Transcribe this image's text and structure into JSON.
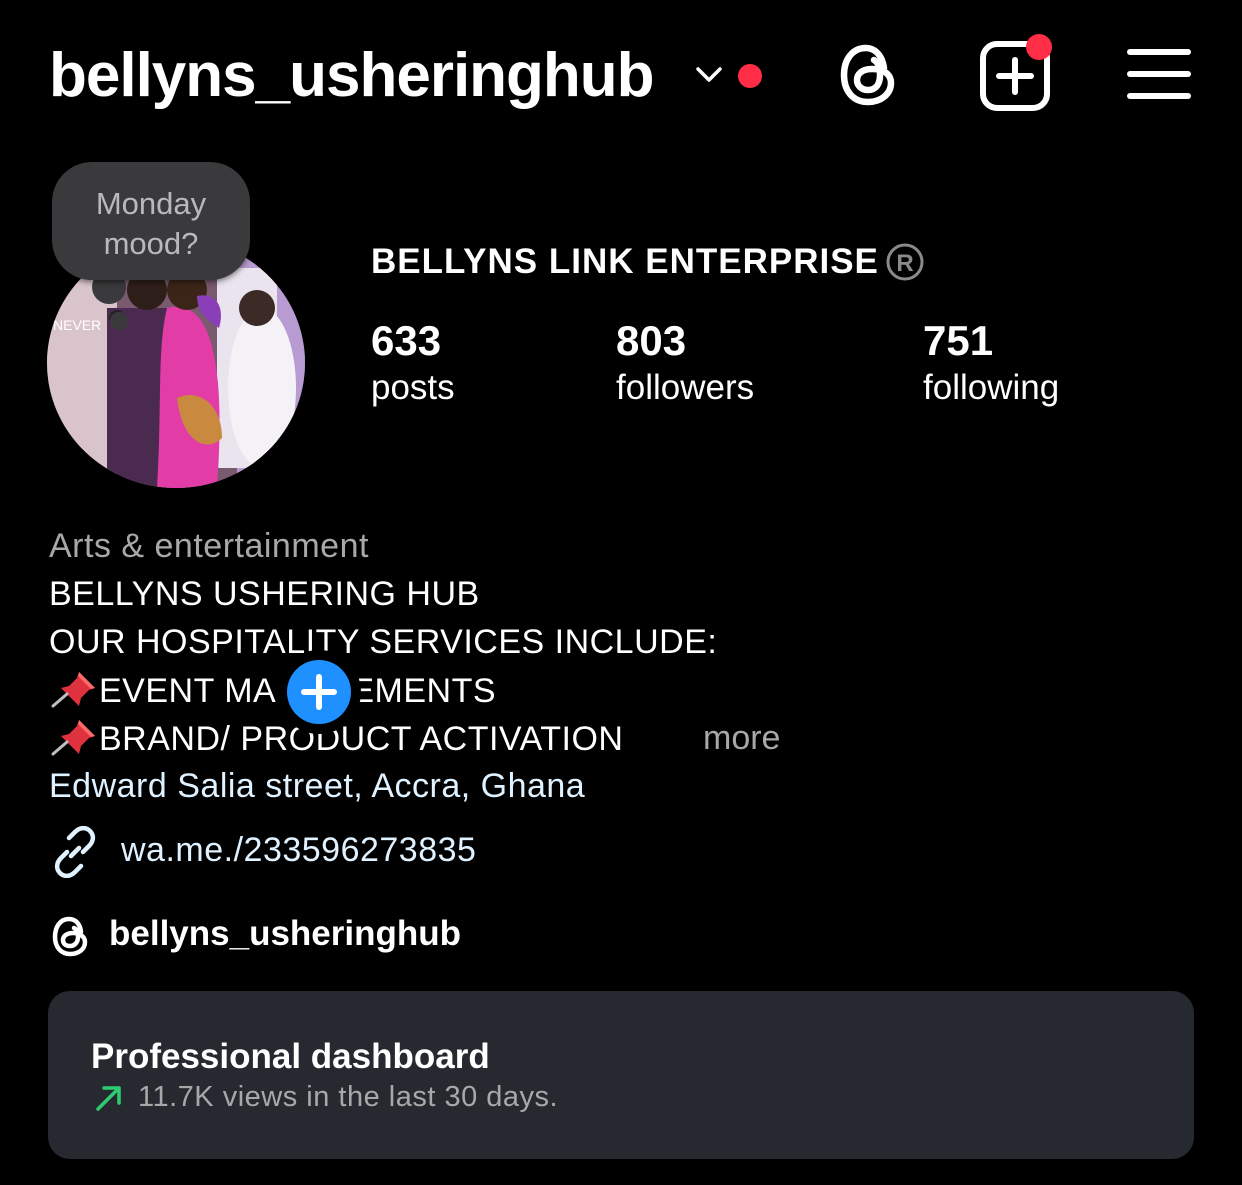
{
  "header": {
    "username": "bellyns_usheringhub",
    "icons": [
      "chevron-down-icon",
      "threads-icon",
      "create-post-icon",
      "hamburger-menu-icon"
    ],
    "notification_color": "#ff2d46"
  },
  "note": {
    "text": "Monday mood?"
  },
  "profile": {
    "display_name": "BELLYNS LINK ENTERPRISE",
    "stats": [
      {
        "value": "633",
        "label": "posts"
      },
      {
        "value": "803",
        "label": "followers"
      },
      {
        "value": "751",
        "label": "following"
      }
    ]
  },
  "bio": {
    "category": "Arts & entertainment",
    "lines": [
      "BELLYNS USHERING HUB",
      "OUR HOSPITALITY SERVICES INCLUDE:",
      "EVENT MANAGEMENTS",
      "BRAND/ PRODUCT ACTIVATION"
    ],
    "more_label": "more",
    "address": "Edward Salia street, Accra, Ghana",
    "link": "wa.me./233596273835",
    "threads_handle": "bellyns_usheringhub"
  },
  "dashboard": {
    "title": "Professional dashboard",
    "subtitle": "11.7K views in the last 30 days.",
    "trend_color": "#2ecc71"
  },
  "colors": {
    "background": "#000000",
    "secondary_text": "#a8a8a8",
    "link_text": "#e0f1ff",
    "add_story_blue": "#1e90ff",
    "card_background": "#262a30"
  }
}
